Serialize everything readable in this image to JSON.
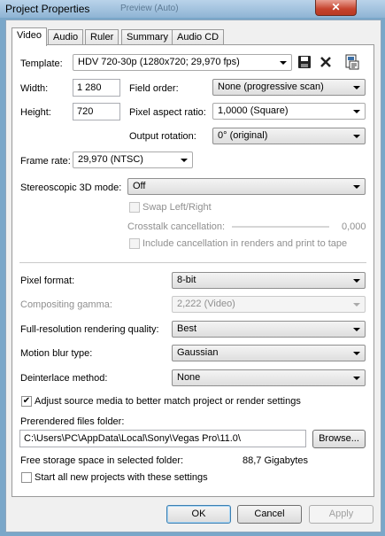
{
  "window": {
    "title": "Project Properties",
    "ghost_title": "Preview (Auto)",
    "close_glyph": "✕"
  },
  "tabs": [
    {
      "label": "Video",
      "active": true
    },
    {
      "label": "Audio"
    },
    {
      "label": "Ruler"
    },
    {
      "label": "Summary"
    },
    {
      "label": "Audio CD"
    }
  ],
  "template": {
    "label": "Template:",
    "value": "HDV 720-30p (1280x720; 29,970 fps)",
    "icons": [
      "save-icon",
      "delete-icon",
      "match-media-icon"
    ]
  },
  "width": {
    "label": "Width:",
    "value": "1 280"
  },
  "height": {
    "label": "Height:",
    "value": "720"
  },
  "field_order": {
    "label": "Field order:",
    "value": "None (progressive scan)"
  },
  "pixel_aspect": {
    "label": "Pixel aspect ratio:",
    "value": "1,0000 (Square)"
  },
  "output_rotation": {
    "label": "Output rotation:",
    "value": "0° (original)"
  },
  "frame_rate": {
    "label": "Frame rate:",
    "value": "29,970 (NTSC)"
  },
  "stereo": {
    "label": "Stereoscopic 3D mode:",
    "value": "Off"
  },
  "swap": {
    "label": "Swap Left/Right"
  },
  "crosstalk": {
    "label": "Crosstalk cancellation:",
    "value": "0,000"
  },
  "include_cancel": {
    "label": "Include cancellation in renders and print to tape"
  },
  "pixel_format": {
    "label": "Pixel format:",
    "value": "8-bit"
  },
  "gamma": {
    "label": "Compositing gamma:",
    "value": "2,222 (Video)"
  },
  "render_quality": {
    "label": "Full-resolution rendering quality:",
    "value": "Best"
  },
  "motion_blur": {
    "label": "Motion blur type:",
    "value": "Gaussian"
  },
  "deinterlace": {
    "label": "Deinterlace method:",
    "value": "None"
  },
  "adjust_media": {
    "label": "Adjust source media to better match project or render settings",
    "checked": true,
    "check_glyph": "✔"
  },
  "prerender": {
    "label": "Prerendered files folder:",
    "value": "C:\\Users\\PC\\AppData\\Local\\Sony\\Vegas Pro\\11.0\\",
    "browse": "Browse..."
  },
  "storage": {
    "label": "Free storage space in selected folder:",
    "value": "88,7 Gigabytes"
  },
  "start_all": {
    "label": "Start all new projects with these settings",
    "checked": false
  },
  "buttons": {
    "ok": "OK",
    "cancel": "Cancel",
    "apply": "Apply"
  },
  "colors": {
    "accent": "#c5432d",
    "titlebar": "#8fb4d4"
  }
}
